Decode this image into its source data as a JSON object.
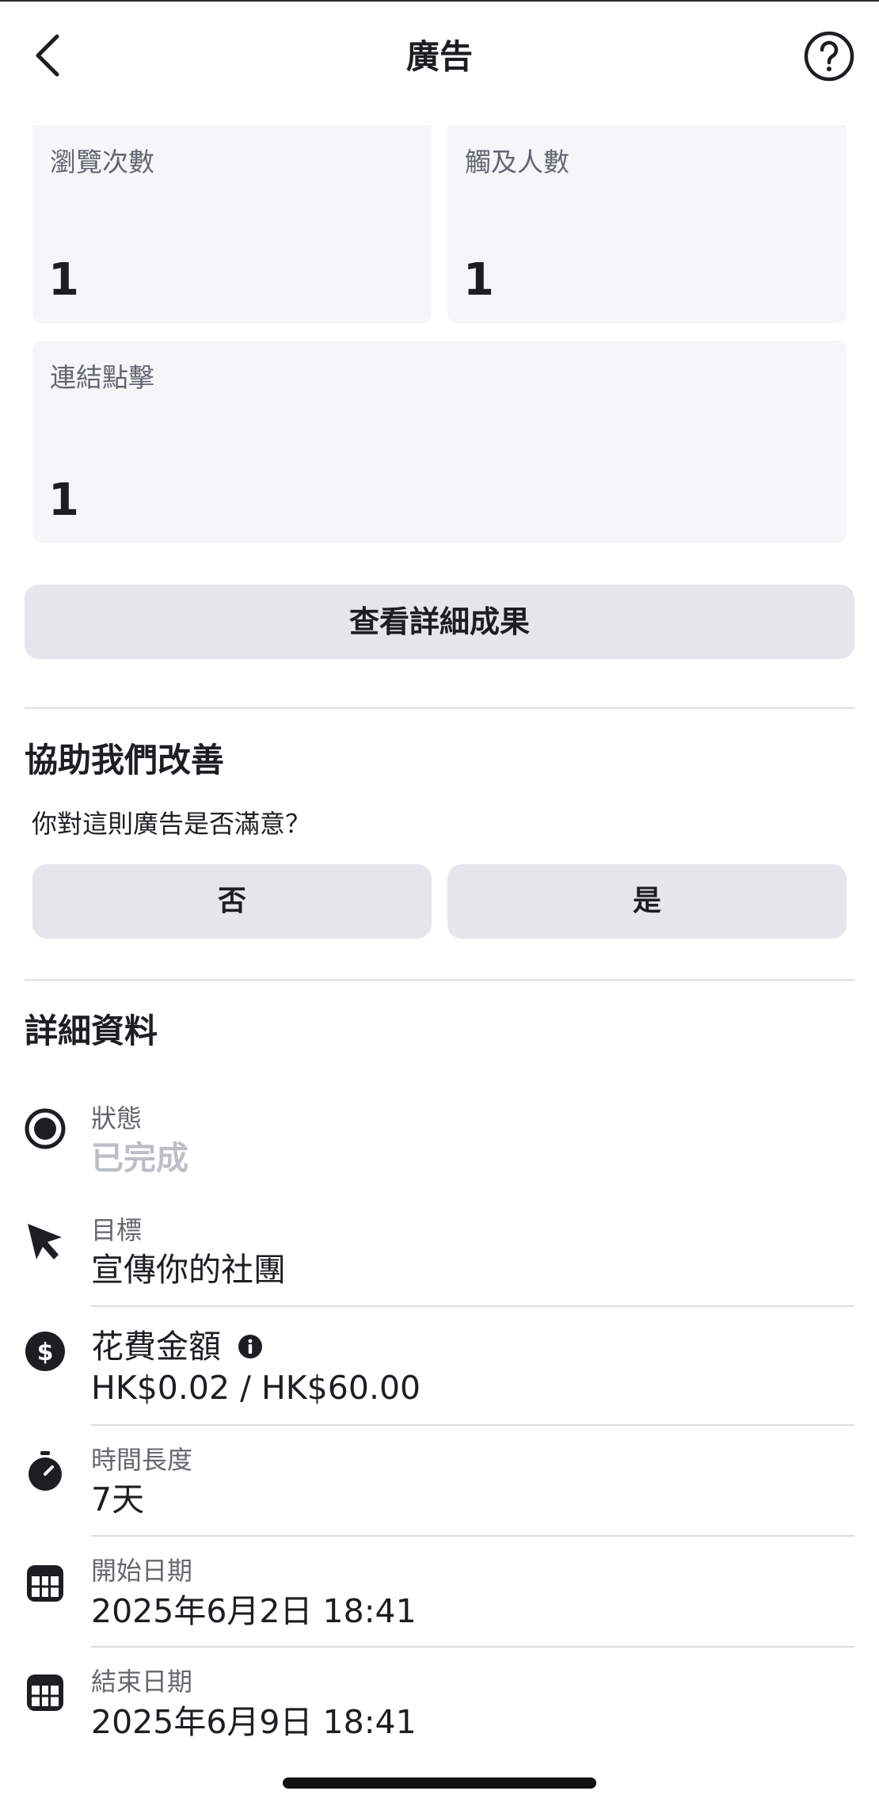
{
  "header": {
    "title": "廣告",
    "back_icon": "chevron-left-icon",
    "help_icon": "question-circle-icon"
  },
  "metrics": {
    "views": {
      "label": "瀏覽次數",
      "value": "1"
    },
    "reach": {
      "label": "觸及人數",
      "value": "1"
    },
    "link_clicks": {
      "label": "連結點擊",
      "value": "1"
    }
  },
  "view_results_button": "查看詳細成果",
  "feedback": {
    "title": "協助我們改善",
    "question": "你對這則廣告是否滿意？",
    "no_label": "否",
    "yes_label": "是"
  },
  "details": {
    "title": "詳細資料",
    "rows": [
      {
        "icon": "radio-on-icon",
        "label": "狀態",
        "value": "已完成"
      },
      {
        "icon": "cursor-icon",
        "label": "目標",
        "value": "宣傳你的社團"
      },
      {
        "icon": "dollar-icon",
        "label": "花費金額",
        "value": "HK$0.02 / HK$60.00",
        "info_icon": "info-icon"
      },
      {
        "icon": "stopwatch-icon",
        "label": "時間長度",
        "value": "7天"
      },
      {
        "icon": "calendar-icon",
        "label": "開始日期",
        "value": "2025年6月2日 18:41"
      },
      {
        "icon": "calendar-icon",
        "label": "結束日期",
        "value": "2025年6月9日 18:41"
      }
    ]
  },
  "colors": {
    "card_bg": "#f5f6f7",
    "button_bg": "#e4e6eb",
    "text": "#1c1e21",
    "secondary": "#65676b",
    "muted": "#bcc0c4"
  }
}
